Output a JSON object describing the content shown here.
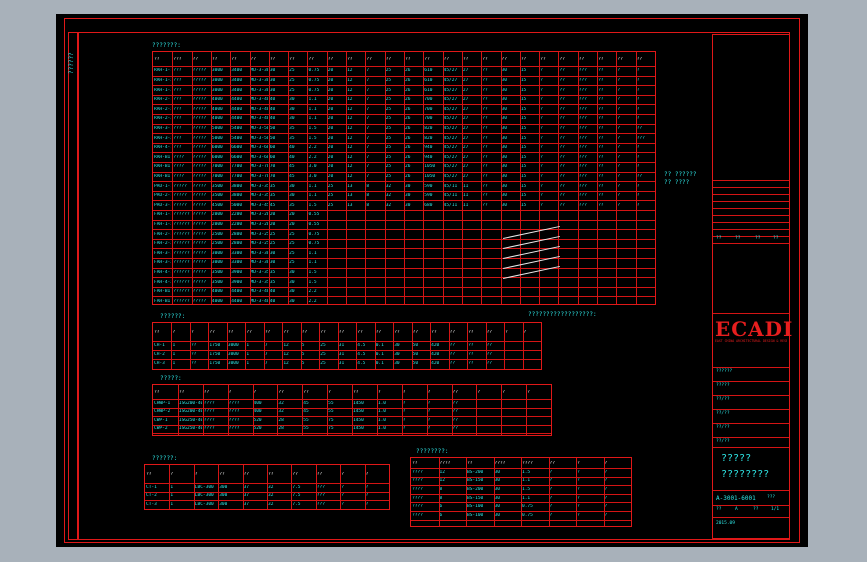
{
  "drawing": {
    "table1_title": "???????:",
    "table2_title": "??????:",
    "table3_title": "?????:",
    "table4_title": "??????:",
    "table5_title": "????????:",
    "right_note": "??????????????????:",
    "side_mark": "??????",
    "company_logo": "ECADI",
    "company_sub": "EAST CHINA ARCHITECTURAL DESIGN & RESEARCH INSTITUTE CO.,LTD",
    "title_main": "?????",
    "title_sub": "????????",
    "drawing_no": "A-3001-6001",
    "scale_label": "???",
    "sheet_label": "??",
    "sheet_value": "1/1",
    "rev_label": "??",
    "rev_value": "A",
    "date_value": "2015.09",
    "info_lines": [
      "??????",
      "?????",
      "??/??",
      "??/??",
      "??/??",
      "??/??"
    ],
    "approval_labels": [
      "??",
      "??",
      "??",
      "??",
      "??"
    ],
    "legend_lines": [
      "?? ??????",
      "?? ????"
    ]
  },
  "big_table": {
    "headers": [
      "??",
      "???",
      "??",
      "??",
      "??",
      "??",
      "??",
      "??",
      "??",
      "??",
      "??",
      "??",
      "??",
      "??",
      "??",
      "??",
      "??",
      "??",
      "??",
      "??",
      "??",
      "??",
      "??",
      "??",
      "??",
      "??"
    ],
    "rows": [
      [
        "RAH-1-1",
        "???",
        "?????",
        "3000",
        "3400",
        "MD-3-30",
        "30",
        "25",
        "0.75",
        "20",
        "12",
        "7",
        "25",
        "26",
        "610",
        "45/27",
        "27",
        "??",
        "30",
        "15",
        "?",
        "??",
        "???",
        "??",
        "?",
        "?"
      ],
      [
        "RAH-1-2",
        "???",
        "?????",
        "3000",
        "3400",
        "MD-3-30",
        "30",
        "25",
        "0.75",
        "20",
        "12",
        "7",
        "25",
        "26",
        "610",
        "45/27",
        "27",
        "??",
        "30",
        "15",
        "?",
        "??",
        "???",
        "??",
        "?",
        "?"
      ],
      [
        "RAH-1-3",
        "???",
        "?????",
        "3000",
        "3400",
        "MD-3-30",
        "30",
        "25",
        "0.75",
        "20",
        "12",
        "7",
        "25",
        "26",
        "610",
        "45/27",
        "27",
        "??",
        "30",
        "15",
        "?",
        "??",
        "???",
        "??",
        "?",
        "?"
      ],
      [
        "RAH-2-1",
        "???",
        "?????",
        "4000",
        "4400",
        "MD-3-40",
        "40",
        "30",
        "1.1",
        "20",
        "12",
        "7",
        "25",
        "26",
        "700",
        "45/27",
        "27",
        "??",
        "30",
        "15",
        "?",
        "??",
        "???",
        "??",
        "?",
        "?"
      ],
      [
        "RAH-2-2",
        "???",
        "?????",
        "4000",
        "4400",
        "MD-3-40",
        "40",
        "30",
        "1.1",
        "20",
        "12",
        "7",
        "25",
        "26",
        "700",
        "45/27",
        "27",
        "??",
        "30",
        "15",
        "?",
        "??",
        "???",
        "??",
        "?",
        "?"
      ],
      [
        "RAH-2-3",
        "???",
        "?????",
        "4000",
        "4400",
        "MD-3-40",
        "40",
        "30",
        "1.1",
        "20",
        "12",
        "7",
        "25",
        "26",
        "700",
        "45/27",
        "27",
        "??",
        "30",
        "15",
        "?",
        "??",
        "???",
        "??",
        "?",
        "?"
      ],
      [
        "RAH-3-1",
        "???",
        "?????",
        "5000",
        "5400",
        "MD-3-50",
        "50",
        "35",
        "1.5",
        "20",
        "12",
        "7",
        "25",
        "26",
        "820",
        "45/27",
        "27",
        "??",
        "30",
        "15",
        "?",
        "??",
        "???",
        "??",
        "?",
        "??"
      ],
      [
        "RAH-3-2",
        "???",
        "?????",
        "5000",
        "5400",
        "MD-3-50",
        "50",
        "35",
        "1.5",
        "20",
        "12",
        "7",
        "25",
        "26",
        "820",
        "45/27",
        "27",
        "??",
        "30",
        "15",
        "?",
        "??",
        "???",
        "??",
        "?",
        "???"
      ],
      [
        "RAH-4-1",
        "???",
        "?????",
        "6000",
        "6600",
        "MD-3-60",
        "60",
        "40",
        "2.2",
        "20",
        "12",
        "7",
        "25",
        "26",
        "940",
        "45/27",
        "27",
        "??",
        "30",
        "15",
        "?",
        "??",
        "???",
        "??",
        "?",
        "?"
      ],
      [
        "RAH-B1-1",
        "????",
        "?????",
        "6000",
        "6600",
        "MD-3-60",
        "60",
        "40",
        "2.2",
        "20",
        "12",
        "7",
        "25",
        "26",
        "940",
        "45/27",
        "27",
        "??",
        "30",
        "15",
        "?",
        "??",
        "???",
        "??",
        "?",
        "?"
      ],
      [
        "RAH-B1-2",
        "????",
        "?????",
        "7000",
        "7700",
        "MD-3-70",
        "70",
        "45",
        "3.0",
        "20",
        "12",
        "7",
        "25",
        "26",
        "1050",
        "45/27",
        "27",
        "??",
        "30",
        "15",
        "?",
        "??",
        "???",
        "??",
        "?",
        "?"
      ],
      [
        "RAH-B1-3",
        "????",
        "?????",
        "7000",
        "7700",
        "MD-3-70",
        "70",
        "45",
        "3.0",
        "20",
        "12",
        "7",
        "25",
        "26",
        "1050",
        "45/27",
        "27",
        "??",
        "30",
        "15",
        "?",
        "??",
        "???",
        "??",
        "?",
        "??"
      ],
      [
        "PAU-1-1",
        "?????",
        "?????",
        "3500",
        "3800",
        "MD-3-35",
        "35",
        "30",
        "1.1",
        "25",
        "13",
        "8",
        "32",
        "30",
        "590",
        "45/11",
        "11",
        "??",
        "30",
        "15",
        "?",
        "??",
        "???",
        "??",
        "?",
        "?"
      ],
      [
        "PAU-2-1",
        "?????",
        "?????",
        "3500",
        "3800",
        "MD-3-35",
        "35",
        "30",
        "1.1",
        "25",
        "13",
        "8",
        "32",
        "30",
        "590",
        "45/11",
        "11",
        "??",
        "30",
        "15",
        "?",
        "??",
        "???",
        "??",
        "?",
        "?"
      ],
      [
        "PAU-3-1",
        "?????",
        "?????",
        "4500",
        "5000",
        "MD-3-45",
        "45",
        "35",
        "1.5",
        "25",
        "13",
        "8",
        "32",
        "30",
        "680",
        "45/11",
        "11",
        "??",
        "30",
        "15",
        "?",
        "??",
        "???",
        "??",
        "?",
        "?"
      ],
      [
        "FAH-1-1",
        "??????",
        "?????",
        "2000",
        "2200",
        "MD-3-20",
        "20",
        "20",
        "0.55",
        "",
        "",
        "",
        "",
        "",
        "",
        "",
        "",
        "",
        "",
        "",
        "",
        "",
        "",
        "",
        "",
        ""
      ],
      [
        "FAH-1-2",
        "??????",
        "?????",
        "2000",
        "2200",
        "MD-3-20",
        "20",
        "20",
        "0.55",
        "",
        "",
        "",
        "",
        "",
        "",
        "",
        "",
        "",
        "",
        "",
        "",
        "",
        "",
        "",
        "",
        ""
      ],
      [
        "FAH-2-1",
        "??????",
        "?????",
        "2500",
        "2800",
        "MD-3-25",
        "25",
        "25",
        "0.75",
        "",
        "",
        "",
        "",
        "",
        "",
        "",
        "",
        "",
        "",
        "",
        "",
        "",
        "",
        "",
        "",
        ""
      ],
      [
        "FAH-2-2",
        "??????",
        "?????",
        "2500",
        "2800",
        "MD-3-25",
        "25",
        "25",
        "0.75",
        "",
        "",
        "",
        "",
        "",
        "",
        "",
        "",
        "",
        "",
        "",
        "",
        "",
        "",
        "",
        "",
        ""
      ],
      [
        "FAH-3-1",
        "??????",
        "?????",
        "3000",
        "3300",
        "MD-3-30",
        "30",
        "25",
        "1.1",
        "",
        "",
        "",
        "",
        "",
        "",
        "",
        "",
        "",
        "",
        "",
        "",
        "",
        "",
        "",
        "",
        ""
      ],
      [
        "FAH-3-2",
        "??????",
        "?????",
        "3000",
        "3300",
        "MD-3-30",
        "30",
        "25",
        "1.1",
        "",
        "",
        "",
        "",
        "",
        "",
        "",
        "",
        "",
        "",
        "",
        "",
        "",
        "",
        "",
        "",
        ""
      ],
      [
        "FAH-4-1",
        "??????",
        "?????",
        "3500",
        "3900",
        "MD-3-35",
        "35",
        "30",
        "1.5",
        "",
        "",
        "",
        "",
        "",
        "",
        "",
        "",
        "",
        "",
        "",
        "",
        "",
        "",
        "",
        "",
        ""
      ],
      [
        "FAH-4-2",
        "??????",
        "?????",
        "3500",
        "3900",
        "MD-3-35",
        "35",
        "30",
        "1.5",
        "",
        "",
        "",
        "",
        "",
        "",
        "",
        "",
        "",
        "",
        "",
        "",
        "",
        "",
        "",
        "",
        ""
      ],
      [
        "FAH-B1-1",
        "??????",
        "?????",
        "4000",
        "4400",
        "MD-3-40",
        "40",
        "30",
        "2.2",
        "",
        "",
        "",
        "",
        "",
        "",
        "",
        "",
        "",
        "",
        "",
        "",
        "",
        "",
        "",
        "",
        ""
      ],
      [
        "FAH-B1-2",
        "??????",
        "?????",
        "4000",
        "4400",
        "MD-3-40",
        "40",
        "30",
        "2.2",
        "",
        "",
        "",
        "",
        "",
        "",
        "",
        "",
        "",
        "",
        "",
        "",
        "",
        "",
        "",
        "",
        ""
      ]
    ]
  },
  "table2": {
    "headers": [
      "??",
      "?",
      "?",
      "??",
      "??",
      "??",
      "??",
      "??",
      "??",
      "??",
      "??",
      "??",
      "??",
      "??",
      "??",
      "??",
      "??",
      "??",
      "??",
      "?",
      "?"
    ],
    "rows": [
      [
        "CH-1",
        "1",
        "??",
        "1750",
        "3000",
        "1",
        "7",
        "12",
        "5",
        "25",
        "31",
        "4.5",
        "0.1",
        "30",
        "50",
        "420",
        "??",
        "??",
        "??",
        "",
        ""
      ],
      [
        "CH-2",
        "1",
        "??",
        "1750",
        "3000",
        "1",
        "7",
        "12",
        "5",
        "25",
        "31",
        "4.5",
        "0.1",
        "30",
        "50",
        "420",
        "??",
        "??",
        "??",
        "",
        ""
      ],
      [
        "CH-3",
        "1",
        "??",
        "1750",
        "3000",
        "1",
        "7",
        "12",
        "5",
        "25",
        "31",
        "4.5",
        "0.1",
        "30",
        "50",
        "420",
        "??",
        "??",
        "??",
        "",
        ""
      ]
    ]
  },
  "table3": {
    "headers": [
      "??",
      "??",
      "??",
      "?",
      "?",
      "??",
      "??",
      "?",
      "??",
      "?",
      "?",
      "?",
      "??",
      "?",
      "?",
      "?"
    ],
    "rows": [
      [
        "CHWP-1",
        "ISG200-400",
        "????",
        "????",
        "400",
        "32",
        "45",
        "55",
        "1450",
        "1.0",
        "?",
        "?",
        "??"
      ],
      [
        "CHWP-2",
        "ISG200-400",
        "????",
        "????",
        "400",
        "32",
        "45",
        "55",
        "1450",
        "1.0",
        "?",
        "?",
        "??"
      ],
      [
        "CWP-1",
        "ISG250-400",
        "????",
        "????",
        "520",
        "28",
        "55",
        "75",
        "1450",
        "1.0",
        "?",
        "?",
        "??"
      ],
      [
        "CWP-2",
        "ISG250-400",
        "????",
        "????",
        "520",
        "28",
        "55",
        "75",
        "1450",
        "1.0",
        "?",
        "?",
        "??"
      ]
    ]
  },
  "table4": {
    "headers": [
      "??",
      "?",
      "?",
      "??",
      "??",
      "??",
      "??",
      "??",
      "?",
      "?"
    ],
    "rows": [
      [
        "CT-1",
        "1",
        "LBC-300",
        "300",
        "37",
        "32",
        "7.5",
        "???",
        "?",
        "?"
      ],
      [
        "CT-2",
        "1",
        "LBC-300",
        "300",
        "37",
        "32",
        "7.5",
        "???",
        "?",
        "?"
      ],
      [
        "CT-3",
        "1",
        "LBC-300",
        "300",
        "37",
        "32",
        "7.5",
        "???",
        "?",
        "?"
      ]
    ]
  },
  "table5": {
    "headers": [
      "??",
      "????",
      "??",
      "????",
      "????",
      "??",
      "?",
      "?"
    ],
    "rows": [
      [
        "????",
        "12",
        "BS-200",
        "30",
        "1.5",
        "?",
        "?",
        "?"
      ],
      [
        "????",
        "12",
        "BS-150",
        "30",
        "1.1",
        "?",
        "?",
        "?"
      ],
      [
        "????",
        "8",
        "BS-200",
        "30",
        "1.5",
        "?",
        "?",
        "?"
      ],
      [
        "????",
        "8",
        "BS-150",
        "30",
        "1.1",
        "?",
        "?",
        "?"
      ],
      [
        "????",
        "6",
        "BS-100",
        "30",
        "0.75",
        "?",
        "?",
        "?"
      ],
      [
        "????",
        "6",
        "BS-100",
        "30",
        "0.75",
        "?",
        "?",
        "?"
      ]
    ]
  }
}
